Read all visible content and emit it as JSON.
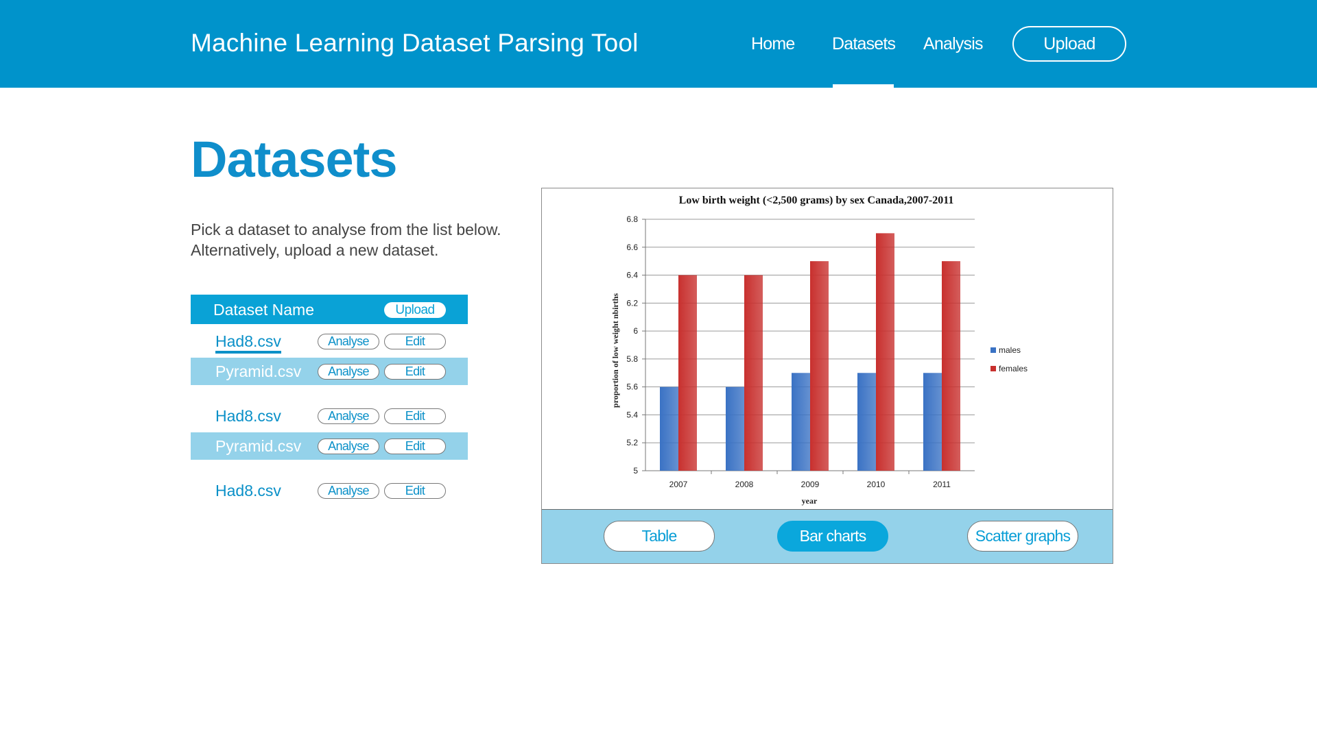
{
  "header": {
    "app_title": "Machine Learning Dataset Parsing Tool",
    "nav": [
      "Home",
      "Datasets",
      "Analysis"
    ],
    "active_nav": "Datasets",
    "upload_label": "Upload"
  },
  "main": {
    "title": "Datasets",
    "intro_line1": "Pick a dataset to analyse from the list below.",
    "intro_line2": "Alternatively, upload a new dataset."
  },
  "dataset_list": {
    "header_label": "Dataset Name",
    "header_upload_label": "Upload",
    "analyse_label": "Analyse",
    "edit_label": "Edit",
    "rows": [
      {
        "name": "Had8.csv",
        "selected": true
      },
      {
        "name": "Pyramid.csv"
      },
      {
        "name": "Had8.csv"
      },
      {
        "name": "Pyramid.csv"
      },
      {
        "name": "Had8.csv"
      }
    ]
  },
  "chart_tabs": {
    "table_label": "Table",
    "bar_label": "Bar charts",
    "scatter_label": "Scatter graphs",
    "active": "Bar charts"
  },
  "chart_data": {
    "type": "bar",
    "title": "Low birth  weight (<2,500 grams) by sex Canada,2007-2011",
    "xlabel": "year",
    "ylabel": "proportion of low weight nbirths",
    "categories": [
      "2007",
      "2008",
      "2009",
      "2010",
      "2011"
    ],
    "series": [
      {
        "name": "males",
        "values": [
          5.6,
          5.6,
          5.7,
          5.7,
          5.7
        ],
        "color": "#3a72c4"
      },
      {
        "name": "females",
        "values": [
          6.4,
          6.4,
          6.5,
          6.7,
          6.5
        ],
        "color": "#c8302e"
      }
    ],
    "ylim": [
      5,
      6.8
    ],
    "yticks": [
      "5",
      "5.2",
      "5.4",
      "5.6",
      "5.8",
      "6",
      "6.2",
      "6.4",
      "6.6",
      "6.8"
    ],
    "grid": true,
    "legend_position": "right"
  },
  "colors": {
    "brand": "#0093cb",
    "accent": "#0aa2d6",
    "row_shade": "#94d2ea"
  }
}
